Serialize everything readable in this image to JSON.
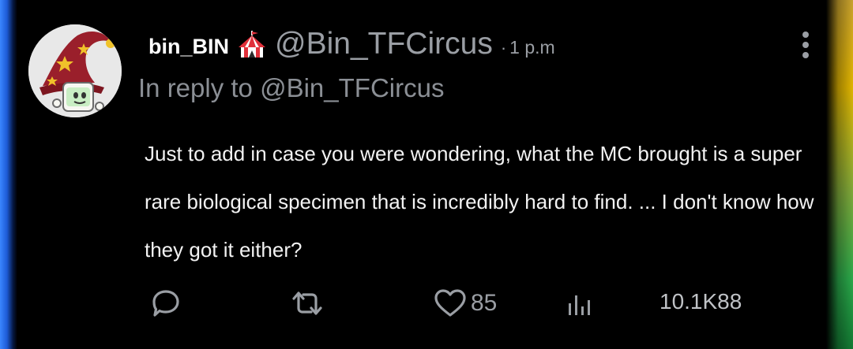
{
  "post": {
    "display_name": "bin_BIN",
    "handle": "@Bin_TFCircus",
    "separator": "·",
    "time": "1 p.m",
    "reply_to": "In reply to @Bin_TFCircus",
    "body": "Just to add in case you were wondering, what the MC brought is a super rare biological specimen that is incredibly hard to find. ... I don't know how they got it either?"
  },
  "actions": {
    "reply_icon": "speech-bubble-icon",
    "repost_icon": "repost-arrows-icon",
    "like_icon": "heart-icon",
    "like_count": "85",
    "views_icon": "bar-chart-icon",
    "views_count": "10.1K88"
  },
  "icons": {
    "badge": "circus-tent-icon",
    "menu": "vertical-dots-icon"
  },
  "colors": {
    "background": "#000000",
    "text": "#f2f2f2",
    "muted": "#9a9ea4",
    "tent_red": "#e0303a"
  }
}
